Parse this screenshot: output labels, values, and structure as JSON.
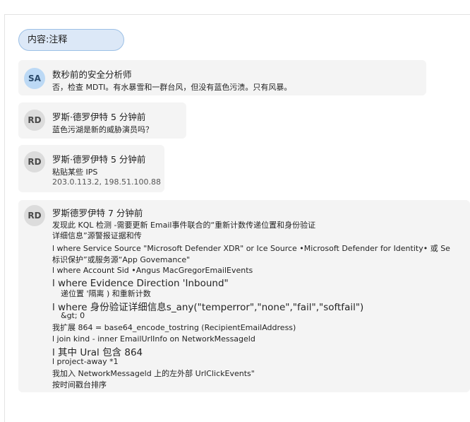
{
  "filter": {
    "label": "内容:注释"
  },
  "comments": [
    {
      "initials": "SA",
      "header": "数秒前的安全分析师",
      "lines": [
        "否，检查 MDTI。有水暴雪和一群台风，但没有蓝色污渍。只有风暴。"
      ]
    },
    {
      "initials": "RD",
      "header": "罗斯·德罗伊特 5 分钟前",
      "lines": [
        "蓝色污湖是新的威胁演员吗？"
      ]
    },
    {
      "initials": "RD",
      "header": "罗斯·德罗伊特 5 分钟前",
      "lines": [
        "粘贴某些 IPS",
        "203.0.113.2, 198.51.100.88"
      ]
    },
    {
      "initials": "RD",
      "header": "罗斯德罗伊特 7 分钟前",
      "lines": [
        "发现此 KQL 检测 -需要更新 Email事件联合的“重新计数传递位置和身份验证",
        "详细信息”源警报证据和传",
        "l where Service Source \"Microsoft Defender XDR\" or Ice Source •Microsoft Defender for Identity• 或 Se",
        "标识保护”或服务源“App Govemance\"",
        "l where Account Sid •Angus MacGregorEmailEvents",
        "l where Evidence Direction 'Inbound\"",
        "递位置 '隔离 ) 和重新计数",
        "l where 身份验证详细信息s_any(\"temperror\",\"none\",\"fail\",\"softfail\")",
        "&gt; 0",
        "我扩展 864 = base64_encode_tostring (RecipientEmailAddress)",
        "l join kind - inner EmailUrlInfo on NetworkMessageld",
        "l 其中 Ural 包含 864",
        "l project-away  *1",
        "我加入 NetworkMessageld 上的左外部 UrlClickEvents\"",
        "按时间戳台排序"
      ]
    }
  ]
}
